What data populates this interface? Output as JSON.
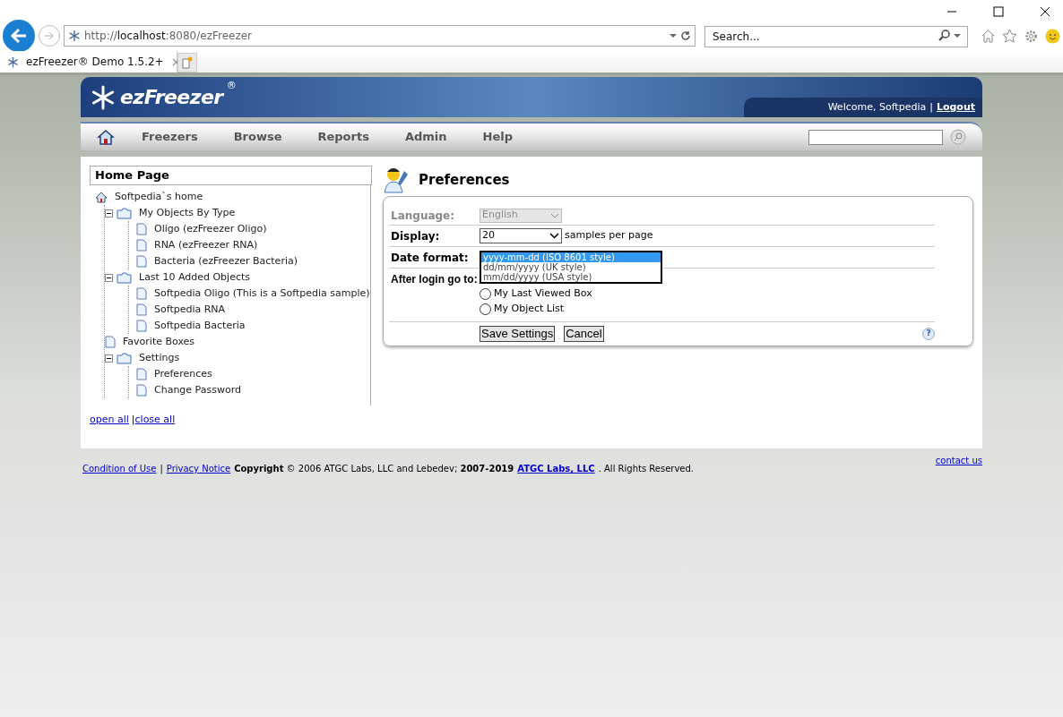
{
  "browser": {
    "address": {
      "scheme": "http://",
      "host": "localhost",
      "rest": ":8080/ezFreezer"
    },
    "search": {
      "placeholder": "Search..."
    },
    "tabs": [
      {
        "title": "ezFreezer® Demo 1.5.2+",
        "selected": true,
        "close": "×"
      }
    ]
  },
  "header": {
    "logo": "ezFreezer",
    "logo_mark": "®",
    "welcome": "Welcome, Softpedia",
    "separator": "|",
    "logout": "Logout"
  },
  "nav": {
    "items": [
      "Freezers",
      "Browse",
      "Reports",
      "Admin",
      "Help"
    ]
  },
  "sidebar": {
    "title": "Home Page",
    "tree": [
      {
        "kind": "home",
        "label": "Softpedia`s home",
        "children": [
          {
            "kind": "folder",
            "label": "My Objects By Type",
            "expanded": true,
            "children": [
              {
                "kind": "page",
                "label": "Oligo (ezFreezer Oligo)"
              },
              {
                "kind": "page",
                "label": "RNA (ezFreezer RNA)"
              },
              {
                "kind": "page",
                "label": "Bacteria (ezFreezer Bacteria)"
              }
            ]
          },
          {
            "kind": "folder",
            "label": "Last 10 Added Objects",
            "expanded": true,
            "children": [
              {
                "kind": "page",
                "label": "Softpedia Oligo (This is a Softpedia sample)"
              },
              {
                "kind": "page",
                "label": "Softpedia RNA"
              },
              {
                "kind": "page",
                "label": "Softpedia Bacteria"
              }
            ]
          },
          {
            "kind": "page",
            "label": "Favorite Boxes"
          },
          {
            "kind": "folder",
            "label": "Settings",
            "expanded": true,
            "children": [
              {
                "kind": "page",
                "label": "Preferences"
              },
              {
                "kind": "page",
                "label": "Change Password"
              }
            ]
          }
        ]
      }
    ],
    "open_all": "open all",
    "divider": "|",
    "close_all": "close all"
  },
  "preferences": {
    "title": "Preferences",
    "language": {
      "label": "Language:",
      "value": "English",
      "disabled": true
    },
    "display": {
      "label": "Display:",
      "value": "20",
      "suffix": "samples per page"
    },
    "date_format": {
      "label": "Date format:",
      "options": [
        {
          "label": "yyyy-mm-dd (ISO 8601 style)",
          "selected": true
        },
        {
          "label": "dd/mm/yyyy (UK style)",
          "selected": false
        },
        {
          "label": "mm/dd/yyyy (USA style)",
          "selected": false
        }
      ]
    },
    "after_login": {
      "label": "After login go to:",
      "options": [
        {
          "label": "My Last Viewed Box",
          "selected": false
        },
        {
          "label": "My Object List",
          "selected": false
        }
      ]
    },
    "buttons": [
      "Save Settings",
      "Cancel"
    ],
    "help": "?"
  },
  "footer": {
    "items": [
      {
        "kind": "link",
        "text": "Condition of Use"
      },
      {
        "kind": "text",
        "text": "|"
      },
      {
        "kind": "link",
        "text": "Privacy Notice"
      },
      {
        "kind": "text",
        "text": "**Copyright** © 2006 ATGC Labs, LLC and Lebedev; **2007-2019**"
      },
      {
        "kind": "link",
        "text": "**ATGC Labs, LLC**"
      },
      {
        "kind": "text",
        "text": ". All Rights Reserved."
      }
    ],
    "contact": "contact us"
  }
}
